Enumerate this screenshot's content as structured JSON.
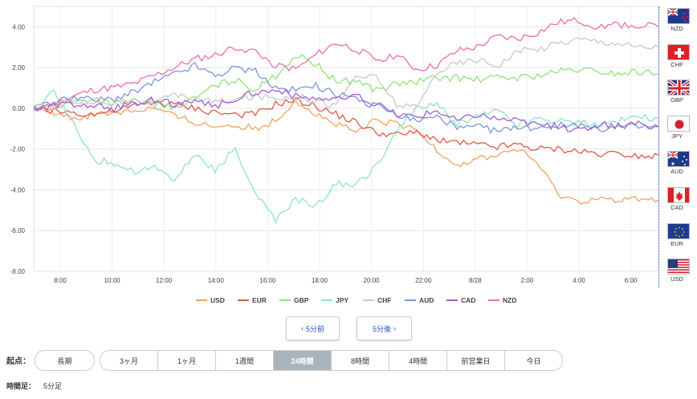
{
  "chart_data": {
    "type": "line",
    "x_tick_labels": [
      "8:00",
      "10:00",
      "12:00",
      "14:00",
      "16:00",
      "18:00",
      "20:00",
      "22:00",
      "8/28",
      "2:00",
      "4:00",
      "6:00"
    ],
    "y_tick_labels": [
      "4.00",
      "2.00",
      "0.00",
      "-2.00",
      "-4.00",
      "-6.00",
      "-8.00"
    ],
    "ylim": [
      -8,
      5
    ],
    "grid": true,
    "legend_position": "bottom",
    "series": [
      {
        "name": "USD",
        "color": "#f0a261",
        "values": [
          0,
          -0.2,
          -0.5,
          -0.3,
          -0.2,
          -0.1,
          0,
          -0.4,
          -0.7,
          -0.9,
          -0.8,
          -1.0,
          -0.6,
          0.4,
          -0.3,
          -0.8,
          -1.2,
          -0.6,
          -0.8,
          -1.1,
          -2.0,
          -2.8,
          -2.5,
          -2.3,
          -2.0,
          -2.7,
          -4.2,
          -4.6,
          -4.4,
          -4.6,
          -4.4,
          -4.5
        ]
      },
      {
        "name": "EUR",
        "color": "#e0584a",
        "values": [
          0,
          -0.1,
          -0.2,
          -0.3,
          -0.1,
          0.1,
          0.3,
          0.2,
          0.0,
          -0.2,
          -0.3,
          -0.3,
          0.2,
          0.4,
          0.1,
          -0.3,
          -0.7,
          -1.2,
          -1.3,
          -1.2,
          -1.5,
          -1.7,
          -1.8,
          -1.9,
          -1.8,
          -2.0,
          -2.0,
          -2.1,
          -2.2,
          -2.2,
          -2.3,
          -2.3
        ]
      },
      {
        "name": "GBP",
        "color": "#8fe37a",
        "values": [
          0,
          0.1,
          0.3,
          0.5,
          0.2,
          0.4,
          0.2,
          0.0,
          0.5,
          1.1,
          1.4,
          0.9,
          1.6,
          2.6,
          2.2,
          1.3,
          1.4,
          0.9,
          1.2,
          1.3,
          1.5,
          1.5,
          1.4,
          1.5,
          1.5,
          1.6,
          1.8,
          1.9,
          1.8,
          1.7,
          1.8,
          1.7
        ]
      },
      {
        "name": "JPY",
        "color": "#8ee3c7",
        "values": [
          0,
          0.8,
          -0.8,
          -2.5,
          -2.7,
          -3.1,
          -2.9,
          -3.5,
          -2.3,
          -3.0,
          -2.0,
          -4.2,
          -5.5,
          -4.5,
          -4.8,
          -3.7,
          -3.8,
          -2.8,
          -1.2,
          0.0,
          0.2,
          -0.8,
          -0.4,
          -0.1,
          -0.8,
          -0.5,
          -0.6,
          -0.7,
          -0.8,
          -0.6,
          -0.4,
          -0.5
        ]
      },
      {
        "name": "CHF",
        "color": "#c9c9c9",
        "values": [
          0,
          0.2,
          0.4,
          0.2,
          0.3,
          0.4,
          0.3,
          0.6,
          0.5,
          0.3,
          0.4,
          0.6,
          0.5,
          0.6,
          0.4,
          0.1,
          1.6,
          1.5,
          0.2,
          0.0,
          1.8,
          2.2,
          2.4,
          2.1,
          2.8,
          2.9,
          3.2,
          3.4,
          3.3,
          3.2,
          3.0,
          3.0
        ]
      },
      {
        "name": "AUD",
        "color": "#7b95de",
        "values": [
          0,
          0.3,
          0.6,
          0.4,
          0.5,
          0.8,
          1.3,
          1.7,
          2.1,
          1.6,
          2.0,
          1.8,
          1.0,
          0.9,
          1.1,
          0.7,
          0.4,
          0.1,
          -0.3,
          -0.6,
          -0.4,
          -1.0,
          -0.9,
          -1.1,
          -1.0,
          -0.9,
          -0.8,
          -0.9,
          -1.0,
          -0.9,
          -0.9,
          -0.9
        ]
      },
      {
        "name": "CAD",
        "color": "#a35ed1",
        "values": [
          0,
          0.1,
          0.2,
          0.1,
          0.0,
          0.3,
          0.4,
          0.2,
          0.3,
          0.1,
          0.5,
          0.8,
          0.9,
          0.6,
          0.5,
          0.4,
          0.6,
          0.2,
          -0.3,
          -0.4,
          -0.1,
          -0.6,
          -0.3,
          -0.5,
          -0.6,
          -0.8,
          -0.9,
          -1.1,
          -0.8,
          -0.9,
          -0.8,
          -0.9
        ]
      },
      {
        "name": "NZD",
        "color": "#ec6fae",
        "values": [
          0,
          0.2,
          0.6,
          0.9,
          1.0,
          1.2,
          1.6,
          2.0,
          2.4,
          2.6,
          3.0,
          2.8,
          2.1,
          1.9,
          2.6,
          3.2,
          2.9,
          2.4,
          2.6,
          1.9,
          2.1,
          2.8,
          3.0,
          3.5,
          3.4,
          3.7,
          4.2,
          4.3,
          4.0,
          4.1,
          4.1,
          4.0
        ]
      }
    ]
  },
  "flags": [
    {
      "code": "NZD",
      "icon": "nz-flag-icon"
    },
    {
      "code": "CHF",
      "icon": "ch-flag-icon"
    },
    {
      "code": "GBP",
      "icon": "uk-flag-icon"
    },
    {
      "code": "JPY",
      "icon": "jp-flag-icon"
    },
    {
      "code": "AUD",
      "icon": "au-flag-icon"
    },
    {
      "code": "CAD",
      "icon": "ca-flag-icon"
    },
    {
      "code": "EUR",
      "icon": "eu-flag-icon"
    },
    {
      "code": "USD",
      "icon": "us-flag-icon"
    }
  ],
  "nav": {
    "prev": "5分前",
    "next": "5分後",
    "prev_icon": "‹",
    "next_icon": "›"
  },
  "range": {
    "label": "起点：",
    "long": "長期",
    "items": [
      "3ヶ月",
      "1ヶ月",
      "1週間",
      "24時間",
      "8時間",
      "4時間",
      "前営業日",
      "今日"
    ],
    "active": "24時間"
  },
  "candle": {
    "label": "時間足：",
    "value": "5分足"
  }
}
